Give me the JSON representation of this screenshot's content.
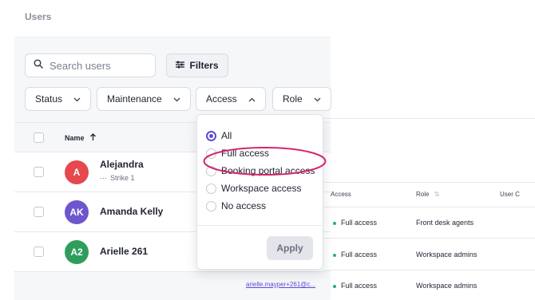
{
  "page": {
    "title": "Users"
  },
  "search": {
    "placeholder": "Search users"
  },
  "toolbar": {
    "filters_label": "Filters"
  },
  "filter_chips": [
    {
      "label": "Status",
      "state": "collapsed"
    },
    {
      "label": "Maintenance",
      "state": "collapsed"
    },
    {
      "label": "Access",
      "state": "expanded"
    },
    {
      "label": "Role",
      "state": "collapsed"
    }
  ],
  "table": {
    "name_header": "Name",
    "rows": [
      {
        "initials": "A",
        "name": "Alejandra",
        "sub": "Strike 1",
        "avatar_color": "#e5484d"
      },
      {
        "initials": "AK",
        "name": "Amanda Kelly",
        "sub": "",
        "avatar_color": "#6e56cf"
      },
      {
        "initials": "A2",
        "name": "Arielle 261",
        "sub": "",
        "avatar_color": "#2f9e5d"
      }
    ]
  },
  "access_dropdown": {
    "options": [
      {
        "label": "All",
        "selected": true
      },
      {
        "label": "Full access",
        "selected": false
      },
      {
        "label": "Booking portal access",
        "selected": false
      },
      {
        "label": "Workspace access",
        "selected": false
      },
      {
        "label": "No access",
        "selected": false
      }
    ],
    "apply_label": "Apply",
    "highlight_color": "#d6246e"
  },
  "right_table": {
    "headers": {
      "access": "Access",
      "role": "Role",
      "user": "User C"
    },
    "rows": [
      {
        "access": "Full access",
        "role": "Front desk agents"
      },
      {
        "access": "Full access",
        "role": "Workspace admins"
      },
      {
        "access": "Full access",
        "role": "Workspace admins"
      }
    ]
  },
  "email_link": "arielle.mayper+261@c...",
  "colors": {
    "accent": "#5b4ad6",
    "status_ok": "#22b07d"
  }
}
